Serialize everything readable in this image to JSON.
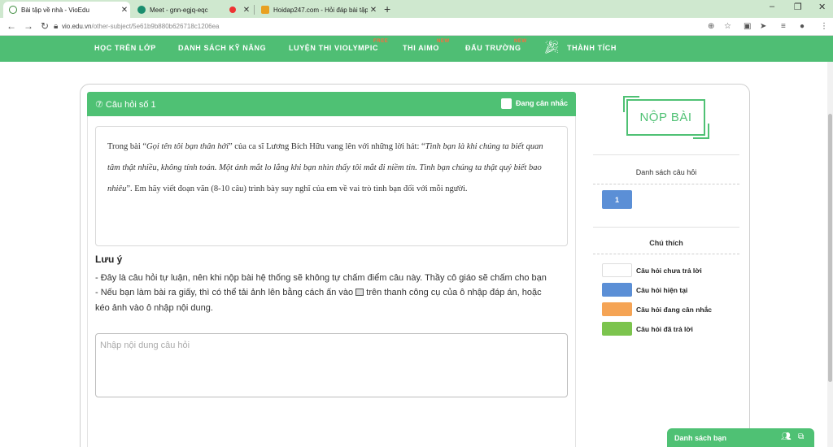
{
  "browser": {
    "tabs": [
      {
        "label": "Bài tập về nhà - VioEdu",
        "icon_color": "#3a8a3a",
        "close": "✕"
      },
      {
        "label": "Meet - gnn-egjq-eqc",
        "icon_color": "#1a8e6e",
        "close": "✕"
      },
      {
        "label": "Hoidap247.com - Hỏi đáp bài tập",
        "icon_color": "#e8a020",
        "close": "✕"
      }
    ],
    "new_tab": "+",
    "url_host": "vio.edu.vn",
    "url_path": "/other-subject/5e61b9b880b626718c1206ea",
    "window_controls": [
      "–",
      "❐",
      "✕"
    ]
  },
  "site_nav": {
    "items": [
      {
        "label": "HỌC TRÊN LỚP",
        "badge": ""
      },
      {
        "label": "DANH SÁCH KỸ NĂNG",
        "badge": ""
      },
      {
        "label": "LUYỆN THI VIOLYMPIC",
        "badge": "FREE"
      },
      {
        "label": "THI AIMO",
        "badge": "NEW"
      },
      {
        "label": "ĐẤU TRƯỜNG",
        "badge": "NEW"
      },
      {
        "label": "THÀNH TÍCH",
        "badge": ""
      }
    ]
  },
  "question": {
    "title": "⑦ Câu hỏi số 1",
    "pending_label": "Đang cân nhắc",
    "text_parts": {
      "p1": "Trong bài “",
      "p2": "Gọi tên tôi bạn thân hởi",
      "p3": "” của ca sĩ Lương Bích Hữu vang lên với những lời hát: “",
      "p4": "Tình bạn là khi chúng ta biết quan tâm thật nhiều, không tính toán. Một ánh mắt lo lắng khi bạn nhìn thấy tôi mắt đi niềm tin. Tình bạn chúng ta thật quý biết bao nhiêu",
      "p5": "”. Em hãy viết đoạn văn (8-10 câu) trình bày suy nghĩ của em về vai trò tình bạn đối với mỗi người."
    }
  },
  "note": {
    "title": "Lưu ý",
    "line1": "- Đây là câu hỏi tự luận, nên khi nộp bài hệ thống sẽ không tự chấm điểm câu này. Thầy cô giáo sẽ chấm cho bạn",
    "line2a": "- Nếu bạn làm bài ra giấy, thì có thể tải ảnh lên bằng cách ấn vào",
    "line2b": "trên thanh công cụ của ô nhập đáp án, hoặc",
    "line3": "kéo ảnh vào ô nhập nội dung."
  },
  "answer": {
    "placeholder": "Nhập nội dung câu hỏi"
  },
  "side": {
    "submit_label": "NỘP BÀI",
    "list_title": "Danh sách câu hỏi",
    "question_numbers": [
      "1"
    ],
    "legend_title": "Chú thích",
    "legend": [
      {
        "label": "Câu hỏi chưa trả lời",
        "color": "#ffffff"
      },
      {
        "label": "Câu hỏi hiện tại",
        "color": "#5b8fd6"
      },
      {
        "label": "Câu hỏi đang cân nhắc",
        "color": "#f5a455"
      },
      {
        "label": "Câu hỏi đã trả lời",
        "color": "#7cc44e"
      }
    ]
  },
  "friends": {
    "label": "Danh sách bạn"
  }
}
